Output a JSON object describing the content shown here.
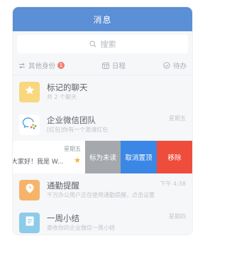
{
  "header": {
    "title": "消息"
  },
  "search": {
    "placeholder": "搜索"
  },
  "filters": {
    "identity": "其他身份",
    "identity_badge": "1",
    "calendar": "日程",
    "todo": "待办"
  },
  "rows": [
    {
      "title": "标记的聊天",
      "preview": "共 2 个聊天",
      "time": "",
      "avatar_color": "#f8d77e",
      "icon": "star-icon"
    },
    {
      "title": "企业微信团队",
      "preview": "[红包]你有一个邀请红包",
      "time": "星期五",
      "avatar_color": "#ffffff",
      "icon": "wecom-logo-icon"
    }
  ],
  "swipe_row": {
    "time": "星期五",
    "preview": "大家好！我是 W...",
    "actions": {
      "mark_unread": "标为未读",
      "unpin": "取消置顶",
      "remove": "移除"
    }
  },
  "rows_bottom": [
    {
      "title": "通勤提醒",
      "preview": "千万办公用户正在使用通勤提醒，点击设置",
      "time": "下午 4:38",
      "avatar_color": "#f6b46a",
      "icon": "clock-icon"
    },
    {
      "title": "一周小结",
      "preview": "查收你的企业微信一周小结",
      "time": "星期四",
      "avatar_color": "#8ecbe8",
      "icon": "document-icon"
    }
  ],
  "colors": {
    "header": "#5b8fd6",
    "mark_unread": "#a5a8ad",
    "unpin": "#3b87e6",
    "remove": "#ef4d3c",
    "star": "#f4b13d"
  }
}
